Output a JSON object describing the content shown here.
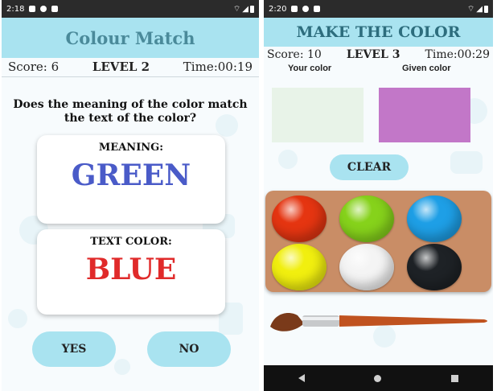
{
  "left": {
    "status_time": "2:18",
    "title": "Colour Match",
    "score": "Score: 6",
    "level": "LEVEL 2",
    "time": "Time:00:19",
    "question": "Does the meaning of the color match the text of the color?",
    "meaning_label": "MEANING:",
    "meaning_word": "GREEN",
    "meaning_word_color": "#4a5bc8",
    "text_color_label": "TEXT COLOR:",
    "text_color_word": "BLUE",
    "text_color_word_color": "#e02a2a",
    "yes_label": "YES",
    "no_label": "NO"
  },
  "right": {
    "status_time": "2:20",
    "title": "MAKE THE COLOR",
    "score": "Score: 10",
    "level": "LEVEL 3",
    "time": "Time:00:29",
    "your_color_label": "Your color",
    "given_color_label": "Given color",
    "your_color": "#e8f3e8",
    "given_color": "#c277c8",
    "clear_label": "CLEAR",
    "paints": [
      {
        "name": "red",
        "color": "#e53511"
      },
      {
        "name": "green",
        "color": "#86d21b"
      },
      {
        "name": "blue",
        "color": "#1e9fe6"
      },
      {
        "name": "yellow",
        "color": "#f1ef0f"
      },
      {
        "name": "white",
        "color": "#f4f4f4"
      },
      {
        "name": "black",
        "color": "#1e2226"
      }
    ]
  }
}
